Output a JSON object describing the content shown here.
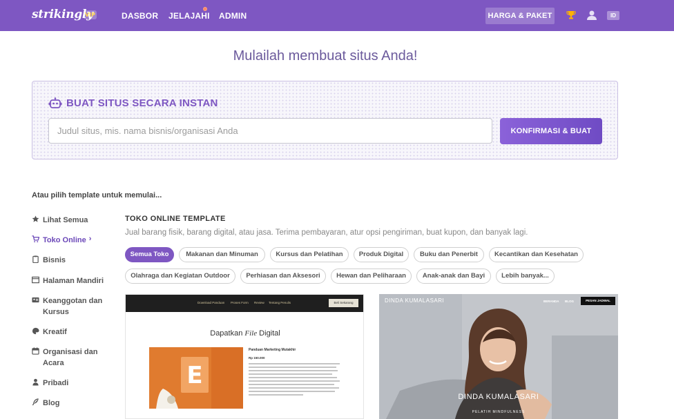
{
  "navbar": {
    "logo": "strikingly",
    "vip_badge": "VIP",
    "links": [
      "DASBOR",
      "JELAJAHI",
      "ADMIN"
    ],
    "pricing_button": "HARGA & PAKET",
    "language": "ID",
    "icons": [
      "trophy-icon",
      "user-icon"
    ]
  },
  "headline": "Mulailah membuat situs Anda!",
  "instant": {
    "title": "BUAT SITUS SECARA INSTAN",
    "input_placeholder": "Judul situs, mis. nama bisnis/organisasi Anda",
    "input_value": "",
    "confirm_button": "KONFIRMASI & BUAT"
  },
  "or_pick": "Atau pilih template untuk memulai...",
  "sidebar": {
    "items": [
      {
        "label": "Lihat Semua",
        "icon": "star-icon"
      },
      {
        "label": "Toko Online",
        "icon": "cart-icon"
      },
      {
        "label": "Bisnis",
        "icon": "clipboard-icon"
      },
      {
        "label": "Halaman Mandiri",
        "icon": "window-icon"
      },
      {
        "label": "Keanggotan dan Kursus",
        "icon": "id-card-icon"
      },
      {
        "label": "Kreatif",
        "icon": "palette-icon"
      },
      {
        "label": "Organisasi dan Acara",
        "icon": "calendar-icon"
      },
      {
        "label": "Pribadi",
        "icon": "person-icon"
      },
      {
        "label": "Blog",
        "icon": "feather-icon"
      }
    ],
    "active_index": 1
  },
  "category": {
    "title": "TOKO ONLINE TEMPLATE",
    "description": "Jual barang fisik, barang digital, atau jasa. Terima pembayaran, atur opsi pengiriman, buat kupon, dan banyak lagi.",
    "filters": [
      "Semua Toko",
      "Makanan dan Minuman",
      "Kursus dan Pelatihan",
      "Produk Digital",
      "Buku dan Penerbit",
      "Kecantikan dan Kesehatan",
      "Olahraga dan Kegiatan Outdoor",
      "Perhiasan dan Aksesori",
      "Hewan dan Peliharaan",
      "Anak-anak dan Bayi",
      "Lebih banyak..."
    ],
    "active_filter": "Semua Toko"
  },
  "templates": [
    {
      "nav": [
        "Download Panduan",
        "Proses Form",
        "Review",
        "Tentang Penulis"
      ],
      "nav_button": "Beli Sekarang",
      "heading_pre": "Dapatkan ",
      "heading_em": "File",
      "heading_post": " Digital",
      "product_title": "Panduan Marketing Mutakhir",
      "product_price": "Rp 150.000"
    },
    {
      "brand": "DINDA KUMALASARI",
      "nav": [
        "BERANDA",
        "BLOG"
      ],
      "nav_button": "PESAN JADWAL",
      "hero_name": "DINDA KUMALASARI",
      "hero_sub": "PELATIH MINDFULNESS"
    }
  ],
  "colors": {
    "brand": "#7e57c2",
    "accent_gradient": [
      "#8b62d9",
      "#6f4bc4"
    ]
  }
}
